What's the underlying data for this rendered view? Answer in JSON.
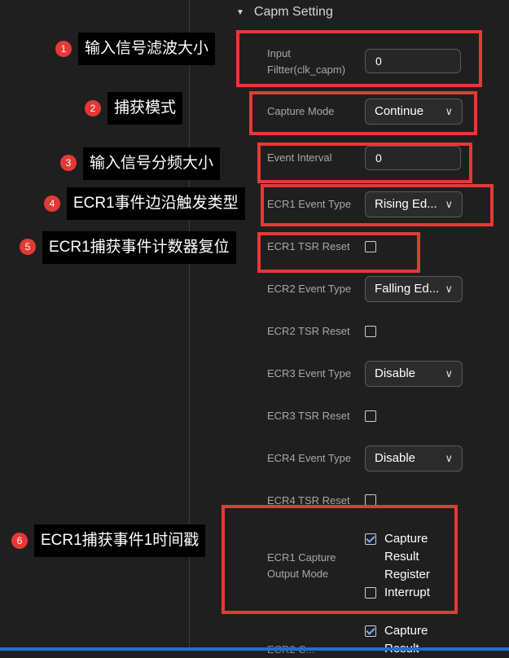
{
  "section": {
    "title": "Capm Setting"
  },
  "fields": {
    "input_filter": {
      "label_line1": "Input",
      "label_line2": "Filtter(clk_capm)",
      "value": "0"
    },
    "capture_mode": {
      "label": "Capture Mode",
      "value": "Continue"
    },
    "event_interval": {
      "label": "Event Interval",
      "value": "0"
    },
    "ecr1_event_type": {
      "label": "ECR1 Event Type",
      "value": "Rising Ed..."
    },
    "ecr1_tsr_reset": {
      "label": "ECR1 TSR Reset",
      "checked": false
    },
    "ecr2_event_type": {
      "label": "ECR2 Event Type",
      "value": "Falling Ed..."
    },
    "ecr2_tsr_reset": {
      "label": "ECR2 TSR Reset",
      "checked": false
    },
    "ecr3_event_type": {
      "label": "ECR3 Event Type",
      "value": "Disable"
    },
    "ecr3_tsr_reset": {
      "label": "ECR3 TSR Reset",
      "checked": false
    },
    "ecr4_event_type": {
      "label": "ECR4 Event Type",
      "value": "Disable"
    },
    "ecr4_tsr_reset": {
      "label": "ECR4 TSR Reset",
      "checked": false
    },
    "ecr1_capture_output_mode": {
      "label_line1": "ECR1 Capture",
      "label_line2": "Output Mode",
      "options": [
        {
          "label_line1": "Capture",
          "label_line2": "Result",
          "label_line3": "Register",
          "checked": true
        },
        {
          "label": "Interrupt",
          "checked": false
        }
      ]
    },
    "ecr2_capture_output_mode": {
      "label_partial": "ECR2 C...",
      "option_label_line1": "Capture",
      "option_label_line2": "Result",
      "checked": true
    }
  },
  "annotations": [
    {
      "number": "1",
      "text": "输入信号滤波大小"
    },
    {
      "number": "2",
      "text": "捕获模式"
    },
    {
      "number": "3",
      "text": "输入信号分频大小"
    },
    {
      "number": "4",
      "text": "ECR1事件边沿触发类型"
    },
    {
      "number": "5",
      "text": "ECR1捕获事件计数器复位"
    },
    {
      "number": "6",
      "text": "ECR1捕获事件1时间戳"
    }
  ],
  "colors": {
    "background": "#1f1f1f",
    "highlight": "#e53935",
    "check": "#6ab7ff",
    "accent_bar": "#1e6fd6"
  }
}
